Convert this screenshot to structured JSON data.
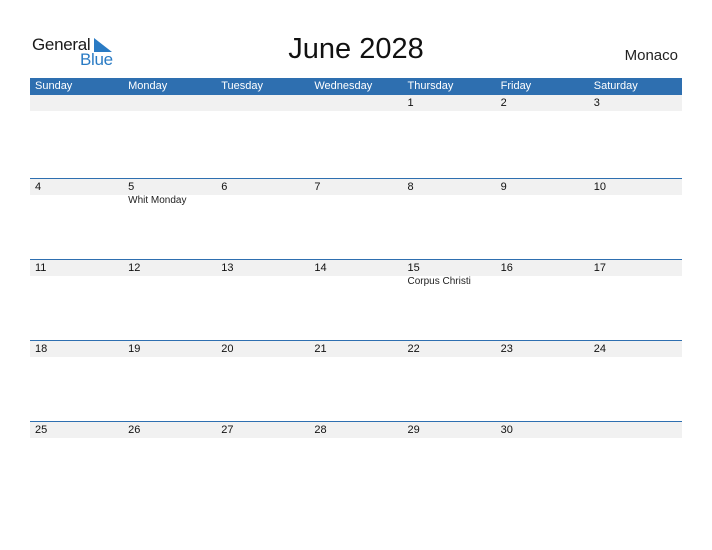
{
  "logo": {
    "word1": "General",
    "word2": "Blue",
    "accent": "#2a7bc4"
  },
  "title": "June 2028",
  "country": "Monaco",
  "colors": {
    "header_bg": "#2e6fb0",
    "date_strip": "#f1f1f1"
  },
  "weekdays": [
    "Sunday",
    "Monday",
    "Tuesday",
    "Wednesday",
    "Thursday",
    "Friday",
    "Saturday"
  ],
  "weeks": [
    {
      "days": [
        {
          "num": "",
          "event": ""
        },
        {
          "num": "",
          "event": ""
        },
        {
          "num": "",
          "event": ""
        },
        {
          "num": "",
          "event": ""
        },
        {
          "num": "1",
          "event": ""
        },
        {
          "num": "2",
          "event": ""
        },
        {
          "num": "3",
          "event": ""
        }
      ]
    },
    {
      "days": [
        {
          "num": "4",
          "event": ""
        },
        {
          "num": "5",
          "event": "Whit Monday"
        },
        {
          "num": "6",
          "event": ""
        },
        {
          "num": "7",
          "event": ""
        },
        {
          "num": "8",
          "event": ""
        },
        {
          "num": "9",
          "event": ""
        },
        {
          "num": "10",
          "event": ""
        }
      ]
    },
    {
      "days": [
        {
          "num": "11",
          "event": ""
        },
        {
          "num": "12",
          "event": ""
        },
        {
          "num": "13",
          "event": ""
        },
        {
          "num": "14",
          "event": ""
        },
        {
          "num": "15",
          "event": "Corpus Christi"
        },
        {
          "num": "16",
          "event": ""
        },
        {
          "num": "17",
          "event": ""
        }
      ]
    },
    {
      "days": [
        {
          "num": "18",
          "event": ""
        },
        {
          "num": "19",
          "event": ""
        },
        {
          "num": "20",
          "event": ""
        },
        {
          "num": "21",
          "event": ""
        },
        {
          "num": "22",
          "event": ""
        },
        {
          "num": "23",
          "event": ""
        },
        {
          "num": "24",
          "event": ""
        }
      ]
    },
    {
      "days": [
        {
          "num": "25",
          "event": ""
        },
        {
          "num": "26",
          "event": ""
        },
        {
          "num": "27",
          "event": ""
        },
        {
          "num": "28",
          "event": ""
        },
        {
          "num": "29",
          "event": ""
        },
        {
          "num": "30",
          "event": ""
        },
        {
          "num": "",
          "event": ""
        }
      ]
    }
  ]
}
